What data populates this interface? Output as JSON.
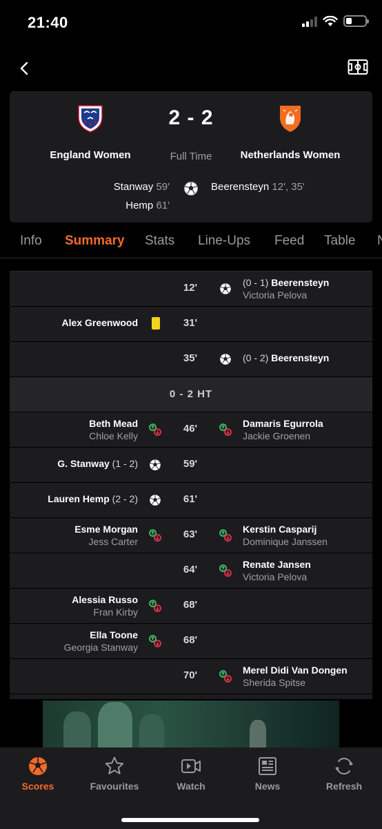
{
  "status_bar": {
    "time": "21:40"
  },
  "match": {
    "home_team": "England Women",
    "away_team": "Netherlands Women",
    "score": "2 - 2",
    "status": "Full Time",
    "home_scorers": [
      {
        "name": "Stanway",
        "minute": "59'"
      },
      {
        "name": "Hemp",
        "minute": "61'"
      }
    ],
    "away_scorers": [
      {
        "name": "Beerensteyn",
        "minute": "12', 35'"
      }
    ]
  },
  "tabs": [
    "Info",
    "Summary",
    "Stats",
    "Line-Ups",
    "Feed",
    "Table",
    "N"
  ],
  "active_tab": "Summary",
  "events": [
    {
      "minute": "12'",
      "away_score": "(0 - 1)",
      "away_player": "Beerensteyn",
      "away_sub": "Victoria Pelova"
    },
    {
      "minute": "31'",
      "home_player": "Alex Greenwood"
    },
    {
      "minute": "35'",
      "away_score": "(0 - 2)",
      "away_player": "Beerensteyn"
    },
    {
      "ht": "0 - 2  HT"
    },
    {
      "minute": "46'",
      "home_player": "Beth Mead",
      "home_sub": "Chloe Kelly",
      "away_player": "Damaris Egurrola",
      "away_sub": "Jackie Groenen"
    },
    {
      "minute": "59'",
      "home_player": "G. Stanway",
      "home_score": "(1 - 2)"
    },
    {
      "minute": "61'",
      "home_player": "Lauren Hemp",
      "home_score": "(2 - 2)"
    },
    {
      "minute": "63'",
      "home_player": "Esme Morgan",
      "home_sub": "Jess Carter",
      "away_player": "Kerstin Casparij",
      "away_sub": "Dominique Janssen"
    },
    {
      "minute": "64'",
      "away_player": "Renate Jansen",
      "away_sub": "Victoria Pelova"
    },
    {
      "minute": "68'",
      "home_player": "Alessia Russo",
      "home_sub": "Fran Kirby"
    },
    {
      "minute": "68'",
      "home_player": "Ella Toone",
      "home_sub": "Georgia Stanway"
    },
    {
      "minute": "70'",
      "away_player": "Merel Didi Van Dongen",
      "away_sub": "Sherida Spitse"
    }
  ],
  "bottom_nav": [
    {
      "label": "Scores",
      "icon": "football-icon",
      "active": true
    },
    {
      "label": "Favourites",
      "icon": "star-icon"
    },
    {
      "label": "Watch",
      "icon": "video-icon"
    },
    {
      "label": "News",
      "icon": "newspaper-icon"
    },
    {
      "label": "Refresh",
      "icon": "refresh-icon"
    }
  ],
  "colors": {
    "accent": "#f26b2d",
    "card_bg": "#1c1c1e",
    "yellow_card": "#f4d21f",
    "sub_in": "#3fbf6a",
    "sub_out": "#e0334a"
  }
}
